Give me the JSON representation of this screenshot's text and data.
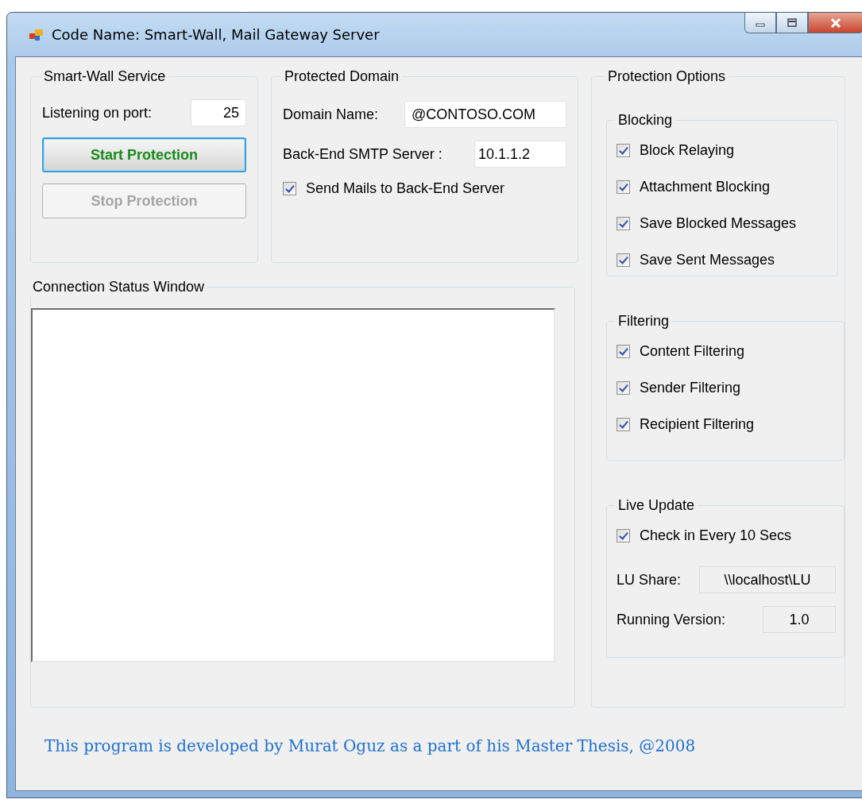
{
  "window": {
    "title": "Code Name: Smart-Wall, Mail Gateway Server"
  },
  "service": {
    "title": "Smart-Wall Service",
    "port_label": "Listening on port:",
    "port": "25",
    "buttons": [
      {
        "label": "Start Protection",
        "disabled": false,
        "focused": true
      },
      {
        "label": "Stop Protection",
        "disabled": true,
        "focused": false
      }
    ]
  },
  "domain": {
    "title": "Protected Domain",
    "fields": [
      {
        "label": "Domain Name:",
        "value": "@CONTOSO.COM"
      },
      {
        "label": "Back-End SMTP Server :",
        "value": "10.1.1.2"
      }
    ],
    "checkbox": {
      "label": "Send Mails to Back-End Server",
      "checked": true
    }
  },
  "status": {
    "title": "Connection Status Window"
  },
  "protection": {
    "title": "Protection Options",
    "groups": [
      {
        "title": "Blocking",
        "options": [
          {
            "label": "Block Relaying",
            "checked": true
          },
          {
            "label": "Attachment Blocking",
            "checked": true
          },
          {
            "label": "Save Blocked Messages",
            "checked": true
          },
          {
            "label": "Save Sent Messages",
            "checked": true
          }
        ]
      },
      {
        "title": "Filtering",
        "options": [
          {
            "label": "Content Filtering",
            "checked": true
          },
          {
            "label": "Sender Filtering",
            "checked": true
          },
          {
            "label": "Recipient Filtering",
            "checked": true
          }
        ]
      },
      {
        "title": "Live Update",
        "options": [
          {
            "label": "Check in Every 10 Secs",
            "checked": true
          }
        ],
        "fields": [
          {
            "label": "LU Share:",
            "value": "\\\\localhost\\LU"
          },
          {
            "label": "Running Version:",
            "value": "1.0"
          }
        ]
      }
    ]
  },
  "footer": "This program is developed by Murat Oguz as a part of his Master Thesis, @2008"
}
